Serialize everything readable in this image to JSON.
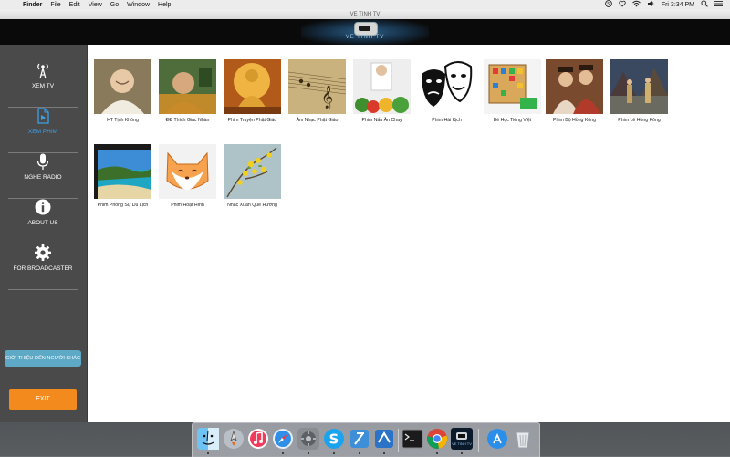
{
  "menubar": {
    "app": "Finder",
    "items": [
      "File",
      "Edit",
      "View",
      "Go",
      "Window",
      "Help"
    ],
    "clock": "Fri 3:34 PM"
  },
  "window": {
    "title": "VE TINH TV"
  },
  "banner": {
    "logo_text": "VE TINH TV"
  },
  "sidebar": {
    "items": [
      {
        "label": "XEM TV",
        "icon": "antenna-icon"
      },
      {
        "label": "XEM PHIM",
        "icon": "film-document-icon",
        "active": true
      },
      {
        "label": "NGHE RADIO",
        "icon": "microphone-icon"
      },
      {
        "label": "ABOUT US",
        "icon": "info-icon"
      },
      {
        "label": "FOR BROADCASTER",
        "icon": "gear-icon"
      }
    ],
    "share_label": "GIỚI THIỆU ĐẾN NGƯỜI KHÁC",
    "exit_label": "EXIT"
  },
  "categories": [
    {
      "label": "HT Tịnh Không"
    },
    {
      "label": "ĐĐ Thích Giác Nhàn"
    },
    {
      "label": "Phim Truyện Phật Giáo"
    },
    {
      "label": "Âm Nhạc Phật Giáo"
    },
    {
      "label": "Phim Nấu Ăn Chay"
    },
    {
      "label": "Phim Hài Kịch"
    },
    {
      "label": "Bé Học Tiếng Việt"
    },
    {
      "label": "Phim Bộ Hồng Kông"
    },
    {
      "label": "Phim Lẻ Hồng Kông"
    },
    {
      "label": "Phim Phóng Sự Du Lịch"
    },
    {
      "label": "Phim Hoạt Hình"
    },
    {
      "label": "Nhạc Xuân Quê Hương"
    }
  ],
  "dock": {
    "apps": [
      "finder-icon",
      "launchpad-icon",
      "music-icon",
      "safari-icon",
      "system-preferences-icon",
      "skype-icon",
      "xcode-icon",
      "xcode-instruments-icon",
      "terminal-icon",
      "chrome-icon",
      "vetinh-tv-icon",
      "app-store-icon",
      "trash-icon"
    ],
    "vetinh_label": "VE TINH TV"
  },
  "colors": {
    "accent": "#3aa0e8",
    "exit": "#f28a1e",
    "share": "#5ea9c6",
    "sidebar": "#4a4a4a"
  }
}
